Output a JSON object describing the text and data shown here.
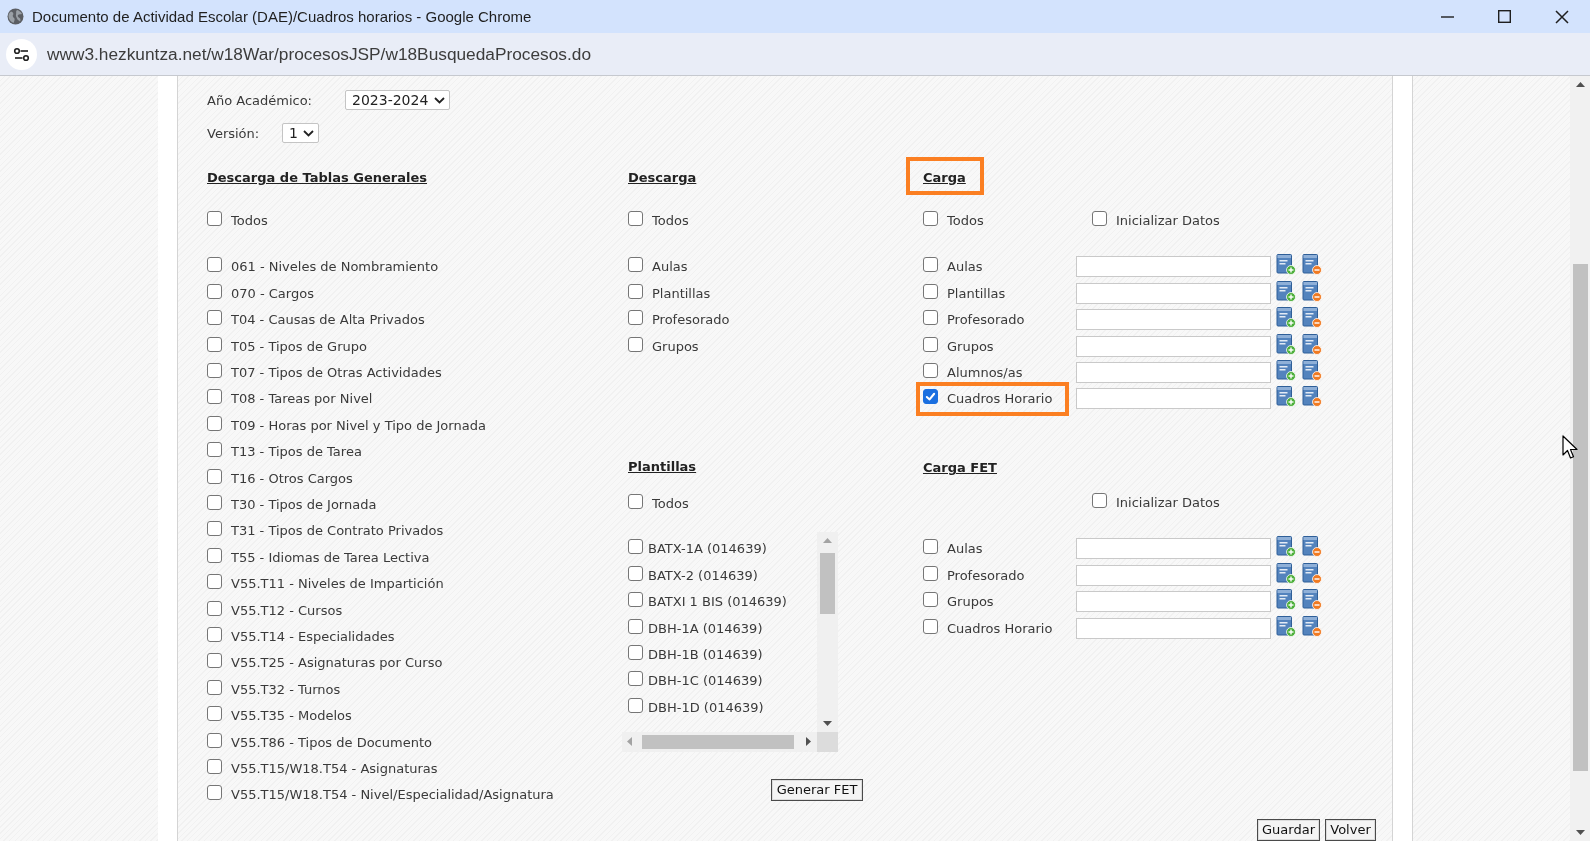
{
  "window": {
    "title": "Documento de Actividad Escolar (DAE)/Cuadros horarios - Google Chrome"
  },
  "address_bar": {
    "url": "www3.hezkuntza.net/w18War/procesosJSP/w18BusquedaProcesos.do"
  },
  "year": {
    "label": "Año Académico:",
    "value": "2023-2024"
  },
  "version": {
    "label": "Versión:",
    "value": "1"
  },
  "tablas_generales": {
    "title": "Descarga de Tablas Generales",
    "all": {
      "label": "Todos",
      "checked": false
    },
    "items": [
      {
        "label": "061 - Niveles de Nombramiento",
        "checked": false
      },
      {
        "label": "070 - Cargos",
        "checked": false
      },
      {
        "label": "T04 - Causas de Alta Privados",
        "checked": false
      },
      {
        "label": "T05 - Tipos de Grupo",
        "checked": false
      },
      {
        "label": "T07 - Tipos de Otras Actividades",
        "checked": false
      },
      {
        "label": "T08 - Tareas por Nivel",
        "checked": false
      },
      {
        "label": "T09 - Horas por Nivel y Tipo de Jornada",
        "checked": false
      },
      {
        "label": "T13 - Tipos de Tarea",
        "checked": false
      },
      {
        "label": "T16 - Otros Cargos",
        "checked": false
      },
      {
        "label": "T30 - Tipos de Jornada",
        "checked": false
      },
      {
        "label": "T31 - Tipos de Contrato Privados",
        "checked": false
      },
      {
        "label": "T55 - Idiomas de Tarea Lectiva",
        "checked": false
      },
      {
        "label": "V55.T11 - Niveles de Impartición",
        "checked": false
      },
      {
        "label": "V55.T12 - Cursos",
        "checked": false
      },
      {
        "label": "V55.T14 - Especialidades",
        "checked": false
      },
      {
        "label": "V55.T25 - Asignaturas por Curso",
        "checked": false
      },
      {
        "label": "V55.T32 - Turnos",
        "checked": false
      },
      {
        "label": "V55.T35 - Modelos",
        "checked": false
      },
      {
        "label": "V55.T86 - Tipos de Documento",
        "checked": false
      },
      {
        "label": "V55.T15/W18.T54 - Asignaturas",
        "checked": false
      },
      {
        "label": "V55.T15/W18.T54 - Nivel/Especialidad/Asignatura",
        "checked": false
      }
    ]
  },
  "descarga": {
    "title": "Descarga",
    "all": {
      "label": "Todos",
      "checked": false
    },
    "items": [
      {
        "label": "Aulas",
        "checked": false
      },
      {
        "label": "Plantillas",
        "checked": false
      },
      {
        "label": "Profesorado",
        "checked": false
      },
      {
        "label": "Grupos",
        "checked": false
      }
    ]
  },
  "plantillas": {
    "title": "Plantillas",
    "all": {
      "label": "Todos",
      "checked": false
    },
    "items": [
      {
        "label": "BATX-1A (014639)",
        "checked": false
      },
      {
        "label": "BATX-2 (014639)",
        "checked": false
      },
      {
        "label": "BATXI 1 BIS (014639)",
        "checked": false
      },
      {
        "label": "DBH-1A (014639)",
        "checked": false
      },
      {
        "label": "DBH-1B (014639)",
        "checked": false
      },
      {
        "label": "DBH-1C (014639)",
        "checked": false
      },
      {
        "label": "DBH-1D (014639)",
        "checked": false
      }
    ]
  },
  "generate_button": "Generar FET",
  "carga": {
    "title": "Carga",
    "highlighted": true,
    "all": {
      "label": "Todos",
      "checked": false
    },
    "init": {
      "label": "Inicializar Datos",
      "checked": false
    },
    "items": [
      {
        "label": "Aulas",
        "checked": false,
        "highlighted": false
      },
      {
        "label": "Plantillas",
        "checked": false,
        "highlighted": false
      },
      {
        "label": "Profesorado",
        "checked": false,
        "highlighted": false
      },
      {
        "label": "Grupos",
        "checked": false,
        "highlighted": false
      },
      {
        "label": "Alumnos/as",
        "checked": false,
        "highlighted": false
      },
      {
        "label": "Cuadros Horario",
        "checked": true,
        "highlighted": true
      }
    ]
  },
  "carga_fet": {
    "title": "Carga FET",
    "init": {
      "label": "Inicializar Datos",
      "checked": false
    },
    "items": [
      {
        "label": "Aulas",
        "checked": false
      },
      {
        "label": "Profesorado",
        "checked": false
      },
      {
        "label": "Grupos",
        "checked": false
      },
      {
        "label": "Cuadros Horario",
        "checked": false
      }
    ]
  },
  "buttons": [
    "Guardar",
    "Volver"
  ]
}
